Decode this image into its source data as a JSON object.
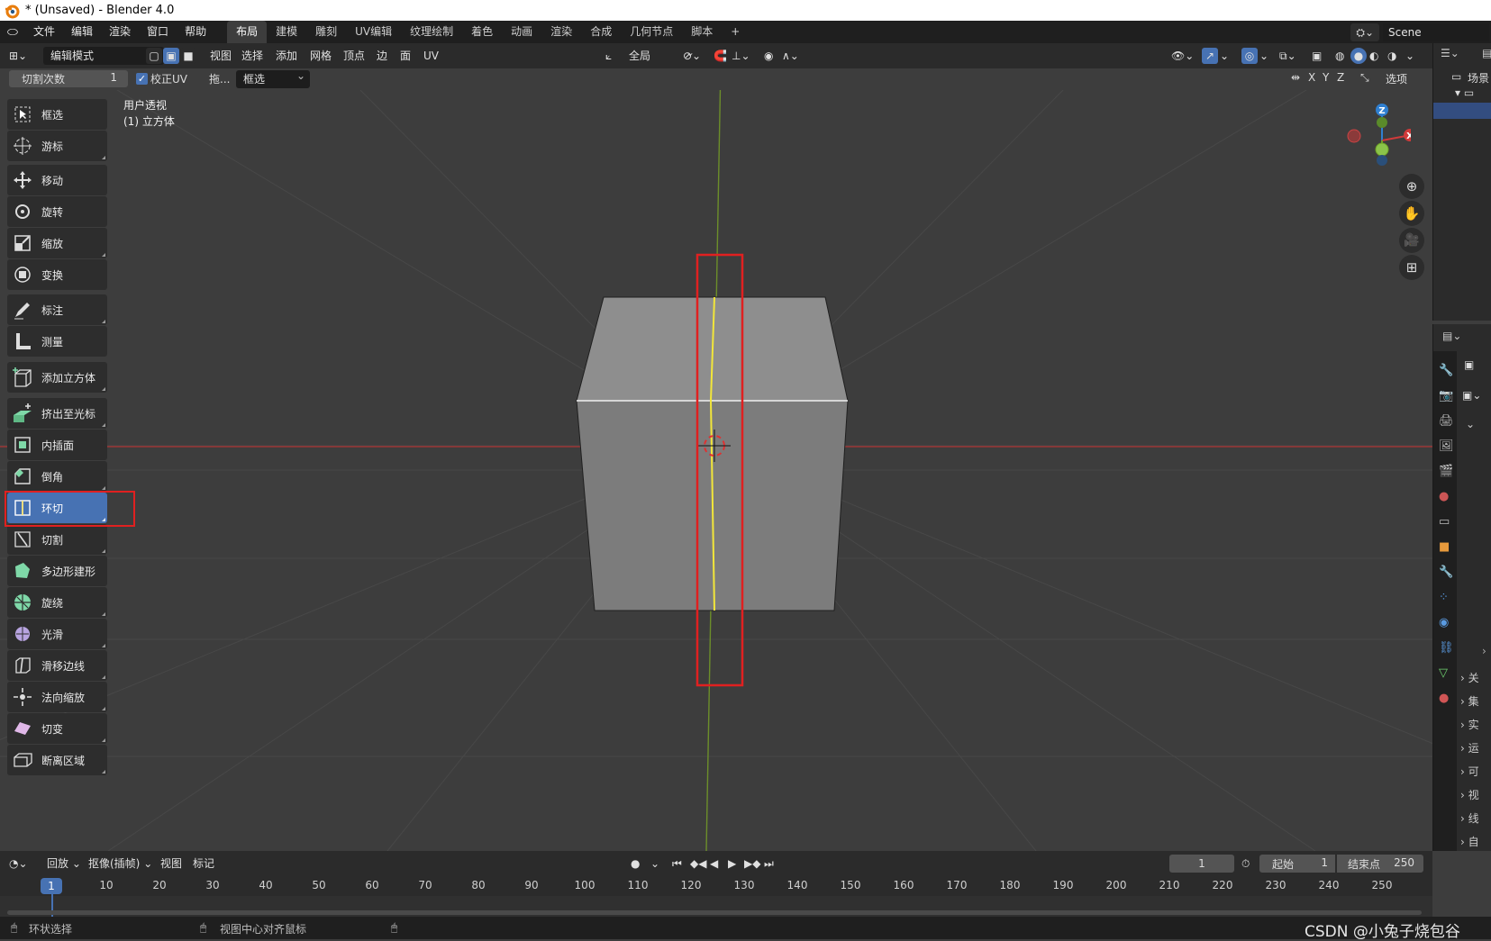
{
  "window": {
    "title": "* (Unsaved) - Blender 4.0"
  },
  "menu": {
    "items": [
      "文件",
      "编辑",
      "渲染",
      "窗口",
      "帮助"
    ],
    "workspaces": [
      "布局",
      "建模",
      "雕刻",
      "UV编辑",
      "纹理绘制",
      "着色",
      "动画",
      "渲染",
      "合成",
      "几何节点",
      "脚本"
    ],
    "add_tab": "+",
    "scene": "Scene"
  },
  "header": {
    "mode": "编辑模式",
    "menus": [
      "视图",
      "选择",
      "添加",
      "网格",
      "顶点",
      "边",
      "面",
      "UV"
    ],
    "orientation": "全局"
  },
  "operator_bar": {
    "cuts_label": "切割次数",
    "cuts_value": "1",
    "correct_uv": "校正UV",
    "drag_label": "拖...",
    "drag_value": "框选",
    "axes": [
      "X",
      "Y",
      "Z"
    ],
    "options": "选项"
  },
  "viewport": {
    "view_name": "用户透视",
    "object_name": "(1) 立方体",
    "gizmo": {
      "z": "Z",
      "x": "X"
    }
  },
  "tools": [
    {
      "label": "框选",
      "icon": "box-select-icon"
    },
    {
      "label": "游标",
      "icon": "cursor-icon"
    },
    {
      "label": "移动",
      "icon": "move-icon"
    },
    {
      "label": "旋转",
      "icon": "rotate-icon"
    },
    {
      "label": "缩放",
      "icon": "scale-icon"
    },
    {
      "label": "变换",
      "icon": "transform-icon"
    },
    {
      "label": "标注",
      "icon": "annotate-icon"
    },
    {
      "label": "测量",
      "icon": "measure-icon"
    },
    {
      "label": "添加立方体",
      "icon": "add-cube-icon"
    },
    {
      "label": "挤出至光标",
      "icon": "extrude-icon"
    },
    {
      "label": "内插面",
      "icon": "inset-icon"
    },
    {
      "label": "倒角",
      "icon": "bevel-icon"
    },
    {
      "label": "环切",
      "icon": "loop-cut-icon",
      "active": true
    },
    {
      "label": "切割",
      "icon": "knife-icon"
    },
    {
      "label": "多边形建形",
      "icon": "poly-build-icon"
    },
    {
      "label": "旋绕",
      "icon": "spin-icon"
    },
    {
      "label": "光滑",
      "icon": "smooth-icon"
    },
    {
      "label": "滑移边线",
      "icon": "edge-slide-icon"
    },
    {
      "label": "法向缩放",
      "icon": "shrink-fatten-icon"
    },
    {
      "label": "切变",
      "icon": "shear-icon"
    },
    {
      "label": "断离区域",
      "icon": "rip-region-icon"
    }
  ],
  "outliner": {
    "scene_collection": "场景"
  },
  "props_tabs": [
    "关",
    "集",
    "实",
    "运",
    "可",
    "视",
    "线",
    "自"
  ],
  "timeline": {
    "playback": "回放",
    "keying": "抠像(插帧)",
    "view": "视图",
    "marker": "标记",
    "current_frame": "1",
    "start_label": "起始",
    "start_value": "1",
    "end_label": "结束点",
    "end_value": "250",
    "ticks": [
      "10",
      "20",
      "30",
      "40",
      "50",
      "60",
      "70",
      "80",
      "90",
      "100",
      "110",
      "120",
      "130",
      "140",
      "150",
      "160",
      "170",
      "180",
      "190",
      "200",
      "210",
      "220",
      "230",
      "240",
      "250"
    ],
    "current_marker": "1"
  },
  "status": {
    "left": "环状选择",
    "middle": "视图中心对齐鼠标"
  },
  "watermark": "CSDN @小兔子烧包谷",
  "colors": {
    "accent": "#4772b3",
    "highlight_box": "#e02020",
    "loop_edge": "#f2e63a"
  }
}
